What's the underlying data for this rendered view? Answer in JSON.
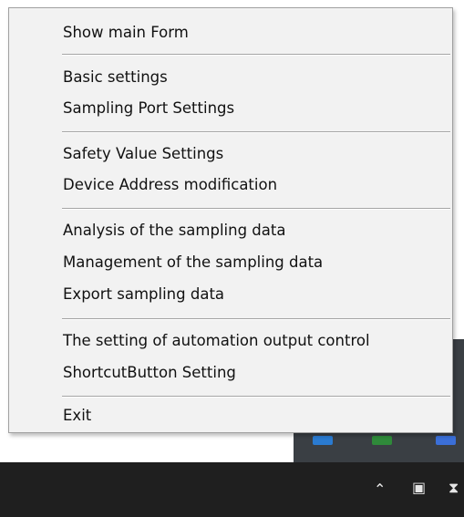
{
  "menu": {
    "items": [
      {
        "label": "Show main Form"
      },
      {
        "label": "Basic settings"
      },
      {
        "label": "Sampling Port Settings"
      },
      {
        "label": "Safety Value Settings"
      },
      {
        "label": "Device Address modification"
      },
      {
        "label": "Analysis of the sampling data"
      },
      {
        "label": "Management of the sampling data"
      },
      {
        "label": "Export sampling data"
      },
      {
        "label": "The setting of automation output control"
      },
      {
        "label": "ShortcutButton Setting"
      },
      {
        "label": "Exit"
      }
    ]
  },
  "taskbar": {
    "icons": [
      "chevron-up-icon",
      "meet-now-icon",
      "wifi-icon"
    ]
  },
  "colors": {
    "menu_bg": "#f2f2f2",
    "separator": "#a5a5a5",
    "taskbar_bg": "#1f1f1f",
    "highlight": "#91c9f7"
  }
}
